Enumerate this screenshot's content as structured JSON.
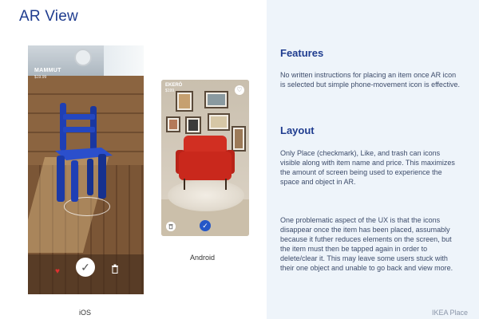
{
  "slide": {
    "title": "AR View"
  },
  "ios": {
    "product_name": "MAMMUT",
    "product_price": "$19.99",
    "caption": "iOS"
  },
  "android": {
    "product_name": "EKERÖ",
    "product_price": "$199",
    "caption": "Android"
  },
  "features": {
    "heading": "Features",
    "text": "No written instructions for placing an item once AR icon is selected but simple phone-movement icon is effective."
  },
  "layout": {
    "heading": "Layout",
    "paragraph1": "Only Place (checkmark), Like, and trash can icons visible along with item name and price. This maximizes the amount of screen being used to experience the space and object in AR.",
    "paragraph2": "One problematic aspect of the UX is that the icons disappear once the item has been placed, assumably because it futher reduces elements on the screen, but the item must then be tapped again in order to delete/clear it. This may leave some users stuck with their one object and unable to go back and view more."
  },
  "footer": {
    "brand": "IKEA Place"
  },
  "icons": {
    "ios_like": "heart-icon",
    "ios_place": "checkmark-icon",
    "ios_delete": "trash-icon",
    "android_like": "heart-icon",
    "android_place": "checkmark-icon",
    "android_delete": "trash-icon"
  },
  "colors": {
    "title": "#1f3c8f",
    "chair_blue": "#1e3fb5",
    "armchair_red": "#c9281c",
    "android_accent": "#2557c7",
    "like_red": "#e03030",
    "right_panel_bg": "#eef4fa"
  }
}
